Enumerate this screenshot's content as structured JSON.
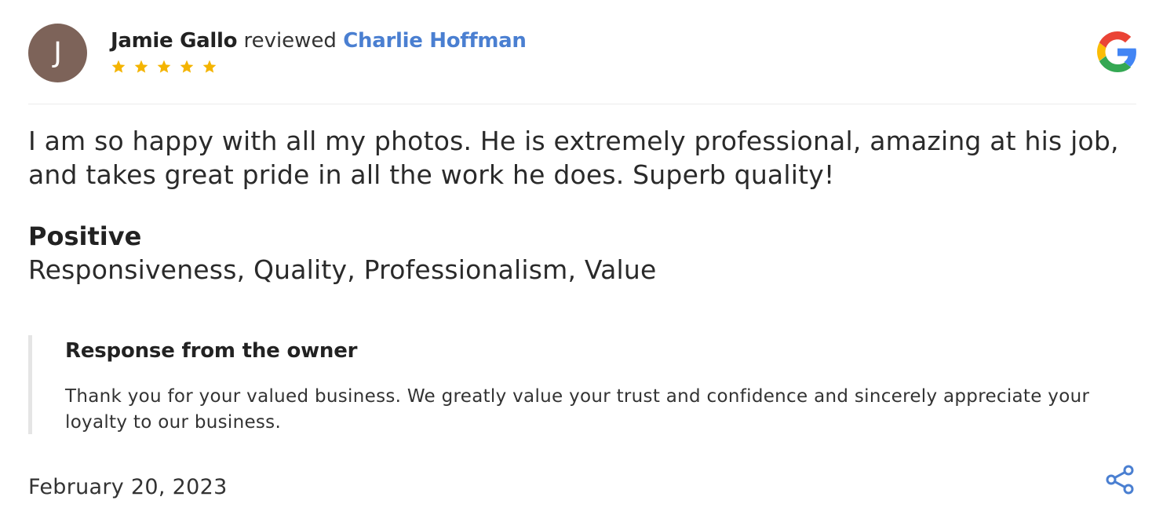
{
  "review": {
    "avatar_initial": "J",
    "reviewer_name": "Jamie Gallo",
    "reviewed_word": "reviewed",
    "business_name": "Charlie Hoffman",
    "rating": 5,
    "rating_max": 5,
    "text": "I am so happy with all my photos. He is extremely professional, amazing at his job, and takes great pride in all the work he does. Superb quality!",
    "positive_title": "Positive",
    "positive_values": "Responsiveness, Quality, Professionalism, Value",
    "date": "February 20, 2023"
  },
  "owner_response": {
    "title": "Response from the owner",
    "text": "Thank you for your valued business. We greatly value your trust and confidence and sincerely appreciate your loyalty to our business."
  },
  "icons": {
    "source": "google-logo-icon",
    "share": "share-icon",
    "star": "star-icon"
  },
  "colors": {
    "avatar_bg": "#7d6359",
    "link": "#4a7fd1",
    "star": "#f4b400",
    "share": "#4a7fd1"
  }
}
